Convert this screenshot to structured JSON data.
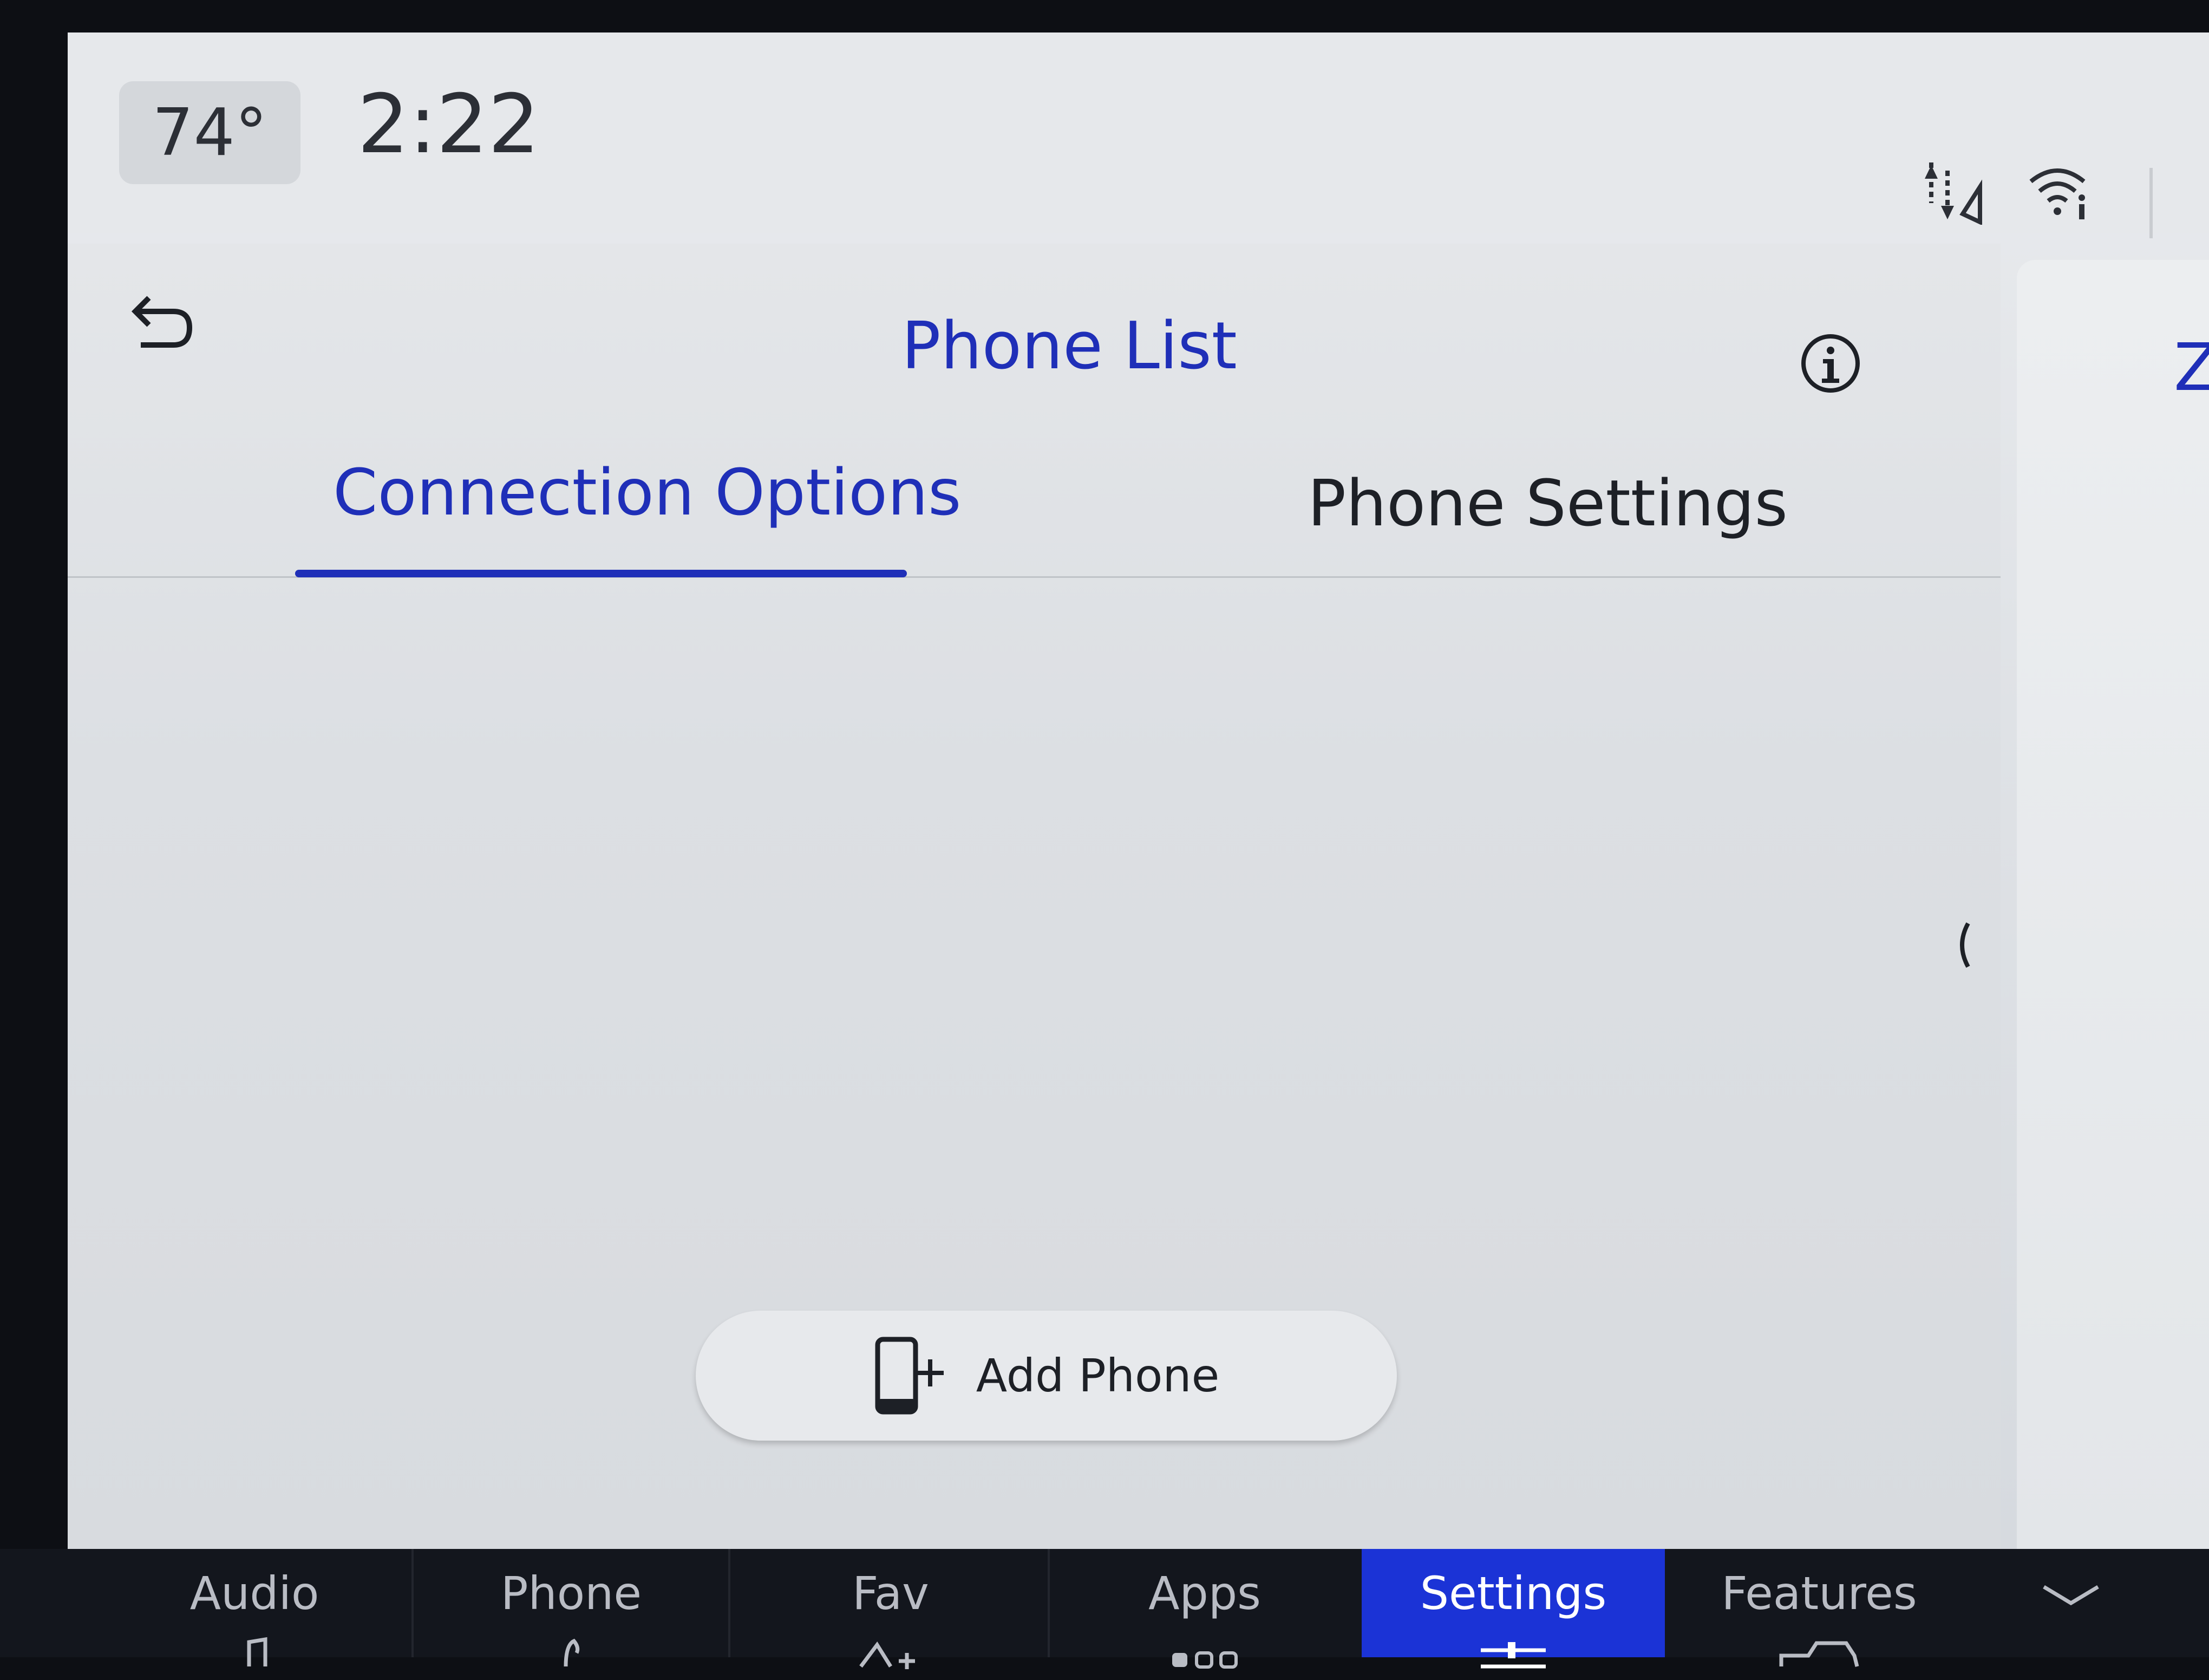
{
  "status_bar": {
    "temperature": "74°",
    "time": "2:22"
  },
  "header": {
    "title": "Phone List"
  },
  "tabs": [
    {
      "label": "Connection Options",
      "active": true
    },
    {
      "label": "Phone Settings",
      "active": false
    }
  ],
  "actions": {
    "add_phone_label": "Add Phone"
  },
  "side_panel": {
    "partial_text": "Zo"
  },
  "bottom_nav": [
    {
      "label": "Audio",
      "icon": "music-note-icon",
      "active": false
    },
    {
      "label": "Phone",
      "icon": "phone-icon",
      "active": false
    },
    {
      "label": "Fav",
      "icon": "star-add-icon",
      "active": false
    },
    {
      "label": "Apps",
      "icon": "apps-dots-icon",
      "active": false
    },
    {
      "label": "Settings",
      "icon": "sliders-icon",
      "active": true
    },
    {
      "label": "Features",
      "icon": "truck-icon",
      "active": false
    }
  ],
  "colors": {
    "accent": "#1f2fb8",
    "nav_active": "#1b33d6",
    "nav_bg": "#13161d",
    "screen_bg": "#e4e6e9"
  }
}
